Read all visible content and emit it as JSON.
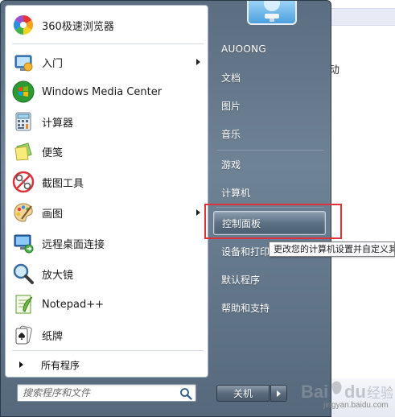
{
  "programs": [
    {
      "label": "360极速浏览器",
      "icon": "browser-360-icon",
      "has_submenu": false
    },
    {
      "label": "入门",
      "icon": "getting-started-icon",
      "has_submenu": true
    },
    {
      "label": "Windows Media Center",
      "icon": "windows-media-center-icon",
      "has_submenu": false
    },
    {
      "label": "计算器",
      "icon": "calculator-icon",
      "has_submenu": false
    },
    {
      "label": "便笺",
      "icon": "sticky-notes-icon",
      "has_submenu": false
    },
    {
      "label": "截图工具",
      "icon": "snipping-tool-icon",
      "has_submenu": false
    },
    {
      "label": "画图",
      "icon": "paint-icon",
      "has_submenu": true
    },
    {
      "label": "远程桌面连接",
      "icon": "remote-desktop-icon",
      "has_submenu": false
    },
    {
      "label": "放大镜",
      "icon": "magnifier-icon",
      "has_submenu": false
    },
    {
      "label": "Notepad++",
      "icon": "notepad-plus-plus-icon",
      "has_submenu": false
    },
    {
      "label": "纸牌",
      "icon": "solitaire-icon",
      "has_submenu": false
    }
  ],
  "all_programs_label": "所有程序",
  "search": {
    "placeholder": "搜索程序和文件",
    "value": ""
  },
  "right_pane": {
    "user": "AUOONG",
    "items": [
      {
        "label": "文档"
      },
      {
        "label": "图片"
      },
      {
        "label": "音乐"
      },
      {
        "label": "游戏"
      },
      {
        "label": "计算机"
      },
      {
        "label": "控制面板"
      },
      {
        "label": "设备和打印机"
      },
      {
        "label": "默认程序"
      },
      {
        "label": "帮助和支持"
      }
    ]
  },
  "tooltip": "更改您的计算机设置并自定义其功能",
  "shutdown_label": "关机",
  "background_text": "动",
  "watermark": {
    "logo": "Bai du 经验",
    "url": "jingyan.baidu.com"
  },
  "colors": {
    "highlight": "#e0323a",
    "menu_bg": "#6f8396"
  }
}
